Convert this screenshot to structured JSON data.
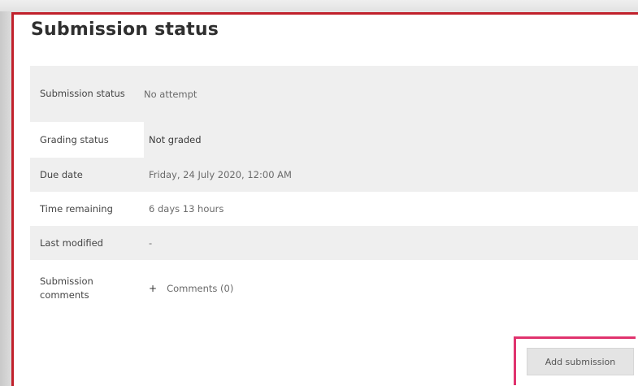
{
  "title": "Submission status",
  "rows": [
    {
      "label": "Submission status",
      "value": "No attempt"
    },
    {
      "label": "Grading status",
      "value": "Not graded"
    },
    {
      "label": "Due date",
      "value": "Friday, 24 July 2020, 12:00 AM"
    },
    {
      "label": "Time remaining",
      "value": "6 days 13 hours"
    },
    {
      "label": "Last modified",
      "value": "-"
    },
    {
      "label": "Submission comments",
      "value": "Comments (0)"
    }
  ],
  "comments_toggle_icon": "plus-icon",
  "add_submission_label": "Add submission",
  "colors": {
    "panel_border": "#c0202b",
    "button_highlight": "#e0336e"
  }
}
